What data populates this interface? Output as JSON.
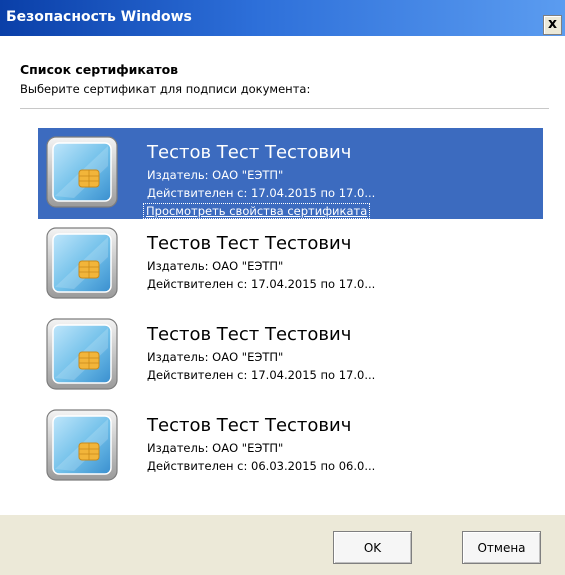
{
  "window": {
    "title": "Безопасность Windows",
    "close_label": "x"
  },
  "header": {
    "title": "Список сертификатов",
    "subtitle": "Выберите сертификат для подписи документа:"
  },
  "certificates": [
    {
      "name": "Тестов Тест Тестович",
      "issuer": "Издатель: ОАО \"ЕЭТП\"",
      "validity": "Действителен с: 17.04.2015 по 17.0...",
      "link": "Просмотреть свойства сертификата",
      "selected": true
    },
    {
      "name": "Тестов Тест Тестович",
      "issuer": "Издатель: ОАО \"ЕЭТП\"",
      "validity": "Действителен с: 17.04.2015 по 17.0...",
      "selected": false
    },
    {
      "name": "Тестов Тест Тестович",
      "issuer": "Издатель: ОАО \"ЕЭТП\"",
      "validity": "Действителен с: 17.04.2015 по 17.0...",
      "selected": false
    },
    {
      "name": "Тестов Тест Тестович",
      "issuer": "Издатель: ОАО \"ЕЭТП\"",
      "validity": "Действителен с: 06.03.2015 по 06.0...",
      "selected": false
    }
  ],
  "buttons": {
    "ok_label": "OK",
    "cancel_label": "Отмена"
  },
  "icons": {
    "certificate": "smart-card-icon",
    "close": "close-icon"
  },
  "colors": {
    "selection": "#3c6bbf",
    "title_gradient_start": "#0a3fa8",
    "title_gradient_end": "#5b9cf0",
    "footer_bg": "#ece9d8"
  }
}
